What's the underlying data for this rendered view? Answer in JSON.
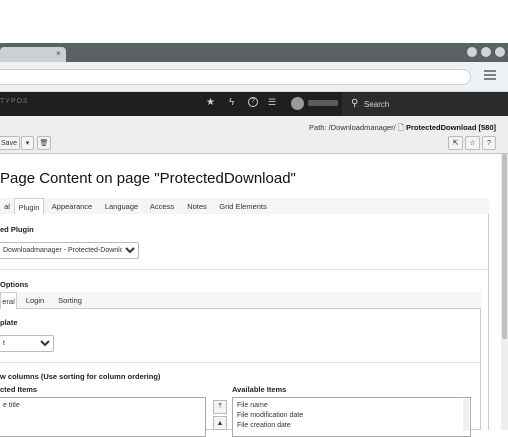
{
  "browser": {
    "tab_close": "×",
    "menu_icon": "hamburger-icon"
  },
  "topbar": {
    "logo": "TYPO3",
    "icons": [
      "star-icon",
      "bolt-icon",
      "help-icon",
      "list-icon"
    ],
    "search_label": "Search"
  },
  "docheader": {
    "save_label": "Save",
    "path_label": "Path: /Downloadmanager/",
    "path_page": "ProtectedDownload [580]"
  },
  "page": {
    "title": "Page Content on page \"ProtectedDownload\""
  },
  "tabs": [
    "al",
    "Plugin",
    "Appearance",
    "Language",
    "Access",
    "Notes",
    "Grid Elements"
  ],
  "plugin": {
    "section_label": "ed Plugin",
    "selected": "Downloadmanager - Protected-Download"
  },
  "options": {
    "section_label": "Options",
    "subtabs": [
      "eral",
      "Login",
      "Sorting"
    ],
    "template_label": "plate",
    "template_value": "t",
    "columns_label": "w columns (Use sorting for column ordering)",
    "selected_label": "cted Items",
    "selected_items": [
      "e title"
    ],
    "available_label": "Available Items",
    "available_items": [
      "File name",
      "File modification date",
      "File creation date"
    ]
  },
  "colors": {
    "topbar": "#1f1f1f",
    "chrome": "#5a6266",
    "docheader": "#eeeeee"
  }
}
